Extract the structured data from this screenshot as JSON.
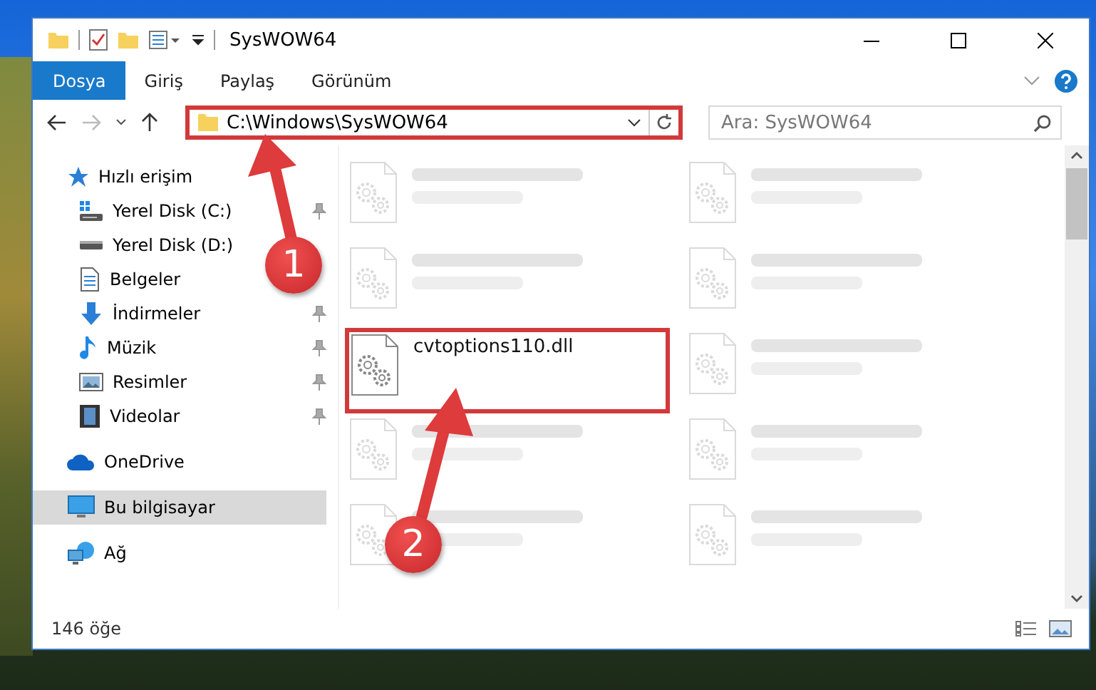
{
  "window": {
    "title": "SysWOW64"
  },
  "ribbon": {
    "tabs": [
      {
        "label": "Dosya",
        "selected": true
      },
      {
        "label": "Giriş",
        "selected": false
      },
      {
        "label": "Paylaş",
        "selected": false
      },
      {
        "label": "Görünüm",
        "selected": false
      }
    ]
  },
  "address": {
    "path": "C:\\Windows\\SysWOW64",
    "highlighted": true
  },
  "search": {
    "placeholder": "Ara: SysWOW64"
  },
  "sidebar": {
    "items": [
      {
        "label": "Hızlı erişim",
        "kind": "star",
        "selected": false,
        "children": [
          {
            "label": "Yerel Disk (C:)",
            "kind": "drive-windows",
            "selected": false,
            "pinned": true
          },
          {
            "label": "Yerel Disk (D:)",
            "kind": "drive",
            "selected": false,
            "pinned": false
          },
          {
            "label": "Belgeler",
            "kind": "documents",
            "selected": false,
            "pinned": false
          },
          {
            "label": "İndirmeler",
            "kind": "downloads",
            "selected": false,
            "pinned": true
          },
          {
            "label": "Müzik",
            "kind": "music",
            "selected": false,
            "pinned": true
          },
          {
            "label": "Resimler",
            "kind": "pictures",
            "selected": false,
            "pinned": true
          },
          {
            "label": "Videolar",
            "kind": "videos",
            "selected": false,
            "pinned": true
          }
        ]
      },
      {
        "label": "OneDrive",
        "kind": "cloud",
        "selected": false
      },
      {
        "label": "Bu bilgisayar",
        "kind": "computer",
        "selected": true
      },
      {
        "label": "Ağ",
        "kind": "network",
        "selected": false
      }
    ]
  },
  "files": [
    {
      "blurred": true,
      "highlighted": false
    },
    {
      "blurred": true,
      "highlighted": false
    },
    {
      "blurred": true,
      "highlighted": false
    },
    {
      "blurred": true,
      "highlighted": false
    },
    {
      "name": "cvtoptions110.dll",
      "blurred": false,
      "highlighted": true
    },
    {
      "blurred": true,
      "highlighted": false
    },
    {
      "blurred": true,
      "highlighted": false
    },
    {
      "blurred": true,
      "highlighted": false
    },
    {
      "blurred": true,
      "highlighted": false
    },
    {
      "blurred": true,
      "highlighted": false
    }
  ],
  "status_bar": {
    "count": "146 öğe"
  },
  "annotations": [
    {
      "label": "1"
    },
    {
      "label": "2"
    }
  ]
}
